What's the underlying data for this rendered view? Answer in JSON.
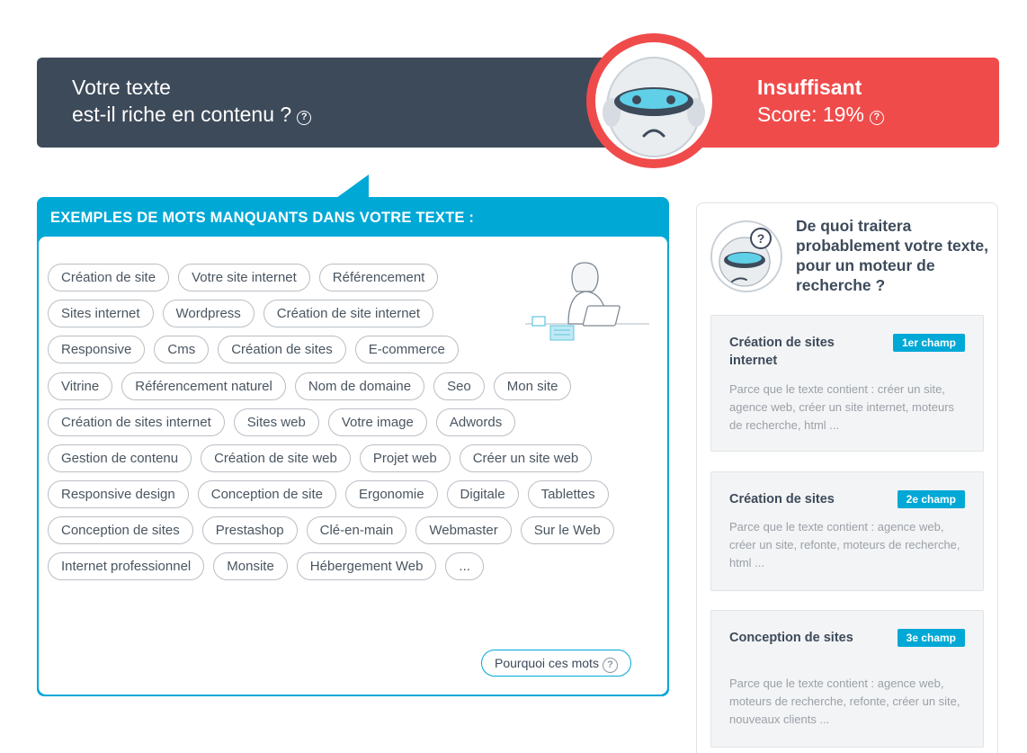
{
  "banner": {
    "question_line1": "Votre texte",
    "question_line2": "est-il riche en contenu ?",
    "verdict": "Insuffisant",
    "score": "Score: 19%",
    "help_glyph": "?",
    "status_color": "#f04b4b",
    "dark_color": "#3d4a5a"
  },
  "missing_words": {
    "header": "EXEMPLES DE MOTS MANQUANTS DANS VOTRE TEXTE :",
    "accent_color": "#00a8d6",
    "tags": [
      "Création de site",
      "Votre site internet",
      "Référencement",
      "Sites internet",
      "Wordpress",
      "Création de site internet",
      "Responsive",
      "Cms",
      "Création de sites",
      "E-commerce",
      "Vitrine",
      "Référencement naturel",
      "Nom de domaine",
      "Seo",
      "Mon site",
      "Création de sites internet",
      "Sites web",
      "Votre image",
      "Adwords",
      "Gestion de contenu",
      "Création de site web",
      "Projet web",
      "Créer un site web",
      "Responsive design",
      "Conception de site",
      "Ergonomie",
      "Digitale",
      "Tablettes",
      "Conception de sites",
      "Prestashop",
      "Clé-en-main",
      "Webmaster",
      "Sur le Web",
      "Internet professionnel",
      "Monsite",
      "Hébergement Web",
      "..."
    ],
    "why_button": "Pourquoi ces mots"
  },
  "topics": {
    "title": "De quoi traitera probablement votre texte, pour un moteur de recherche ?",
    "cards": [
      {
        "title": "Création de sites internet",
        "badge": "1er champ",
        "text": "Parce que le texte contient :   créer un site, agence web, créer un site internet, moteurs de recherche, html ..."
      },
      {
        "title": "Création de sites",
        "badge": "2e champ",
        "text": "Parce que le texte contient :   agence web, créer un site, refonte, moteurs de recherche, html ..."
      },
      {
        "title": "Conception de sites",
        "badge": "3e champ",
        "text": "Parce que le texte contient :   agence web, moteurs de recherche, refonte, créer un site, nouveaux clients ..."
      }
    ]
  }
}
